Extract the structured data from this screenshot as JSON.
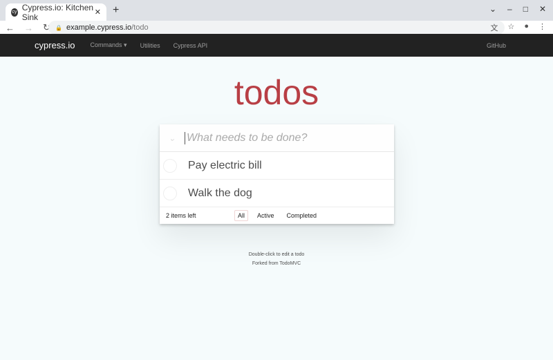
{
  "browser": {
    "tab_title": "Cypress.io: Kitchen Sink",
    "url_host": "example.cypress.io",
    "url_path": "/todo"
  },
  "nav": {
    "brand": "cypress.io",
    "items": [
      "Commands ▾",
      "Utilities",
      "Cypress API"
    ],
    "github": "GitHub"
  },
  "app": {
    "title": "todos",
    "placeholder": "What needs to be done?",
    "todos": [
      "Pay electric bill",
      "Walk the dog"
    ],
    "count": "2 items left",
    "filters": [
      "All",
      "Active",
      "Completed"
    ]
  },
  "info": {
    "hint": "Double-click to edit a todo",
    "forked": "Forked from TodoMVC"
  },
  "colors": {
    "accent": "#b83f45",
    "navbar": "#222222"
  }
}
